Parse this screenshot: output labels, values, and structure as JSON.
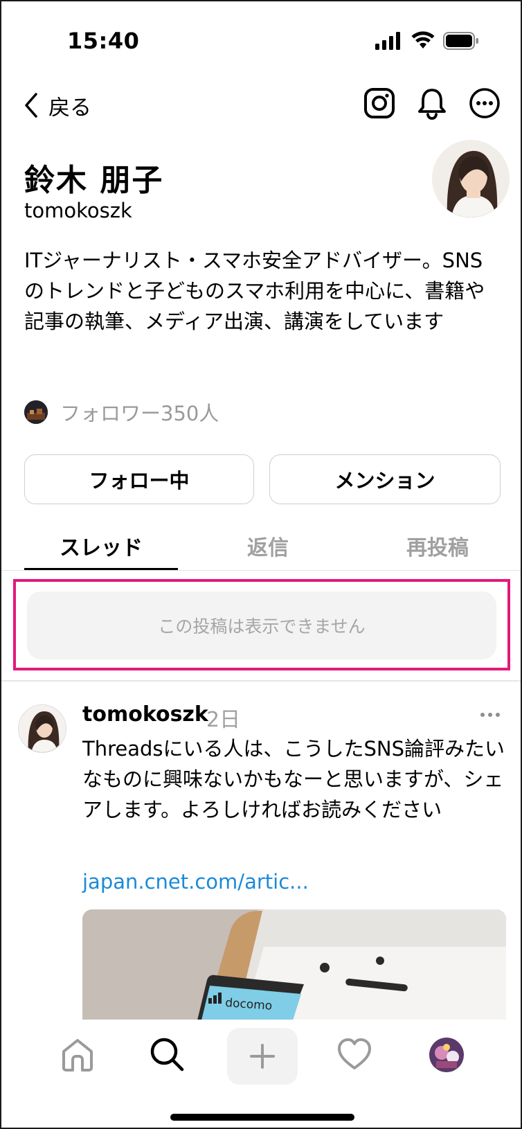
{
  "status_bar": {
    "time": "15:40",
    "icons": [
      "signal-icon",
      "wifi-icon",
      "battery-icon"
    ]
  },
  "nav": {
    "back_label": "戻る",
    "icons": [
      "instagram-icon",
      "bell-icon",
      "more-options-icon"
    ]
  },
  "profile": {
    "name": "鈴木 朋子",
    "handle": "tomokoszk",
    "bio": "ITジャーナリスト・スマホ安全アドバイザー。SNSのトレンドと子どものスマホ利用を中心に、書籍や記事の執筆、メディア出演、講演をしています",
    "followers_label": "フォロワー350人"
  },
  "actions": {
    "following_label": "フォロー中",
    "mention_label": "メンション"
  },
  "tabs": [
    {
      "label": "スレッド",
      "active": true
    },
    {
      "label": "返信",
      "active": false
    },
    {
      "label": "再投稿",
      "active": false
    }
  ],
  "hidden_post": {
    "message": "この投稿は表示できません"
  },
  "post": {
    "username": "tomokoszk",
    "time": "2日",
    "text": "Threadsにいる人は、こうしたSNS論評みたいなものに興味ないかもなーと思いますが、シェアします。よろしければお読みください",
    "link": "japan.cnet.com/artic...",
    "image_carrier_text": "docomo"
  },
  "tab_bar": {
    "icons": [
      "home-icon",
      "search-icon",
      "plus-icon",
      "heart-icon",
      "profile-avatar"
    ]
  },
  "colors": {
    "highlight": "#e3197b",
    "link": "#1a8ad8",
    "muted": "#a0a0a0"
  }
}
